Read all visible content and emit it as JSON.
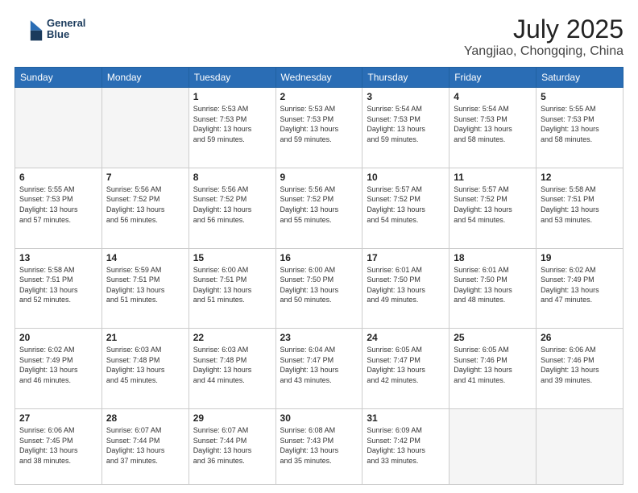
{
  "header": {
    "logo_line1": "General",
    "logo_line2": "Blue",
    "month": "July 2025",
    "location": "Yangjiao, Chongqing, China"
  },
  "days_of_week": [
    "Sunday",
    "Monday",
    "Tuesday",
    "Wednesday",
    "Thursday",
    "Friday",
    "Saturday"
  ],
  "weeks": [
    [
      {
        "day": "",
        "info": ""
      },
      {
        "day": "",
        "info": ""
      },
      {
        "day": "1",
        "info": "Sunrise: 5:53 AM\nSunset: 7:53 PM\nDaylight: 13 hours\nand 59 minutes."
      },
      {
        "day": "2",
        "info": "Sunrise: 5:53 AM\nSunset: 7:53 PM\nDaylight: 13 hours\nand 59 minutes."
      },
      {
        "day": "3",
        "info": "Sunrise: 5:54 AM\nSunset: 7:53 PM\nDaylight: 13 hours\nand 59 minutes."
      },
      {
        "day": "4",
        "info": "Sunrise: 5:54 AM\nSunset: 7:53 PM\nDaylight: 13 hours\nand 58 minutes."
      },
      {
        "day": "5",
        "info": "Sunrise: 5:55 AM\nSunset: 7:53 PM\nDaylight: 13 hours\nand 58 minutes."
      }
    ],
    [
      {
        "day": "6",
        "info": "Sunrise: 5:55 AM\nSunset: 7:53 PM\nDaylight: 13 hours\nand 57 minutes."
      },
      {
        "day": "7",
        "info": "Sunrise: 5:56 AM\nSunset: 7:52 PM\nDaylight: 13 hours\nand 56 minutes."
      },
      {
        "day": "8",
        "info": "Sunrise: 5:56 AM\nSunset: 7:52 PM\nDaylight: 13 hours\nand 56 minutes."
      },
      {
        "day": "9",
        "info": "Sunrise: 5:56 AM\nSunset: 7:52 PM\nDaylight: 13 hours\nand 55 minutes."
      },
      {
        "day": "10",
        "info": "Sunrise: 5:57 AM\nSunset: 7:52 PM\nDaylight: 13 hours\nand 54 minutes."
      },
      {
        "day": "11",
        "info": "Sunrise: 5:57 AM\nSunset: 7:52 PM\nDaylight: 13 hours\nand 54 minutes."
      },
      {
        "day": "12",
        "info": "Sunrise: 5:58 AM\nSunset: 7:51 PM\nDaylight: 13 hours\nand 53 minutes."
      }
    ],
    [
      {
        "day": "13",
        "info": "Sunrise: 5:58 AM\nSunset: 7:51 PM\nDaylight: 13 hours\nand 52 minutes."
      },
      {
        "day": "14",
        "info": "Sunrise: 5:59 AM\nSunset: 7:51 PM\nDaylight: 13 hours\nand 51 minutes."
      },
      {
        "day": "15",
        "info": "Sunrise: 6:00 AM\nSunset: 7:51 PM\nDaylight: 13 hours\nand 51 minutes."
      },
      {
        "day": "16",
        "info": "Sunrise: 6:00 AM\nSunset: 7:50 PM\nDaylight: 13 hours\nand 50 minutes."
      },
      {
        "day": "17",
        "info": "Sunrise: 6:01 AM\nSunset: 7:50 PM\nDaylight: 13 hours\nand 49 minutes."
      },
      {
        "day": "18",
        "info": "Sunrise: 6:01 AM\nSunset: 7:50 PM\nDaylight: 13 hours\nand 48 minutes."
      },
      {
        "day": "19",
        "info": "Sunrise: 6:02 AM\nSunset: 7:49 PM\nDaylight: 13 hours\nand 47 minutes."
      }
    ],
    [
      {
        "day": "20",
        "info": "Sunrise: 6:02 AM\nSunset: 7:49 PM\nDaylight: 13 hours\nand 46 minutes."
      },
      {
        "day": "21",
        "info": "Sunrise: 6:03 AM\nSunset: 7:48 PM\nDaylight: 13 hours\nand 45 minutes."
      },
      {
        "day": "22",
        "info": "Sunrise: 6:03 AM\nSunset: 7:48 PM\nDaylight: 13 hours\nand 44 minutes."
      },
      {
        "day": "23",
        "info": "Sunrise: 6:04 AM\nSunset: 7:47 PM\nDaylight: 13 hours\nand 43 minutes."
      },
      {
        "day": "24",
        "info": "Sunrise: 6:05 AM\nSunset: 7:47 PM\nDaylight: 13 hours\nand 42 minutes."
      },
      {
        "day": "25",
        "info": "Sunrise: 6:05 AM\nSunset: 7:46 PM\nDaylight: 13 hours\nand 41 minutes."
      },
      {
        "day": "26",
        "info": "Sunrise: 6:06 AM\nSunset: 7:46 PM\nDaylight: 13 hours\nand 39 minutes."
      }
    ],
    [
      {
        "day": "27",
        "info": "Sunrise: 6:06 AM\nSunset: 7:45 PM\nDaylight: 13 hours\nand 38 minutes."
      },
      {
        "day": "28",
        "info": "Sunrise: 6:07 AM\nSunset: 7:44 PM\nDaylight: 13 hours\nand 37 minutes."
      },
      {
        "day": "29",
        "info": "Sunrise: 6:07 AM\nSunset: 7:44 PM\nDaylight: 13 hours\nand 36 minutes."
      },
      {
        "day": "30",
        "info": "Sunrise: 6:08 AM\nSunset: 7:43 PM\nDaylight: 13 hours\nand 35 minutes."
      },
      {
        "day": "31",
        "info": "Sunrise: 6:09 AM\nSunset: 7:42 PM\nDaylight: 13 hours\nand 33 minutes."
      },
      {
        "day": "",
        "info": ""
      },
      {
        "day": "",
        "info": ""
      }
    ]
  ]
}
